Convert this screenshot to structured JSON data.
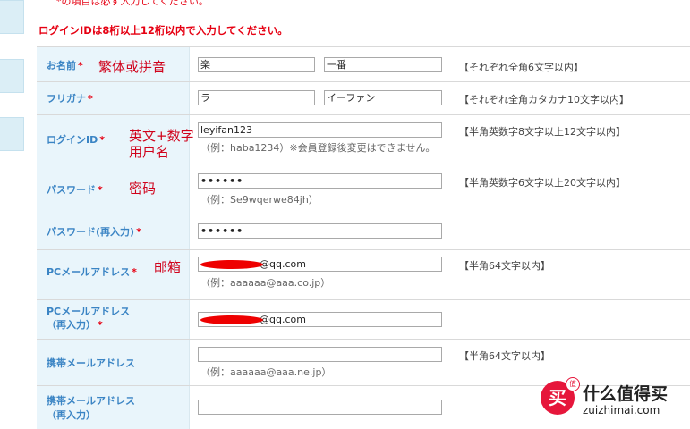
{
  "notice_required": "*の項目は必ず入力してください。",
  "warning": "ログインIDは8桁以上12桁以内で入力してください。",
  "rows": {
    "name": {
      "label": "お名前",
      "required_mark": "*",
      "annotation": "繁体或拼音",
      "last_value": "楽",
      "first_value": "一番",
      "rule": "【それぞれ全角6文字以内】"
    },
    "furigana": {
      "label": "フリガナ",
      "required_mark": "*",
      "last_value": "ラ",
      "first_value": "イーファン",
      "rule": "【それぞれ全角カタカナ10文字以内】"
    },
    "login_id": {
      "label": "ログインID",
      "required_mark": "*",
      "annotation_line1": "英文+数字",
      "annotation_line2": "用户名",
      "value": "leyifan123",
      "hint": "（例：haba1234）※会員登録後変更はできません。",
      "rule": "【半角英数字8文字以上12文字以内】"
    },
    "password": {
      "label": "パスワード",
      "required_mark": "*",
      "annotation": "密码",
      "value": "••••••",
      "hint": "（例：Se9wqerwe84jh）",
      "rule": "【半角英数字6文字以上20文字以内】"
    },
    "password_confirm": {
      "label": "パスワード(再入力)",
      "required_mark": "*",
      "value": "••••••"
    },
    "pc_email": {
      "label": "PCメールアドレス",
      "required_mark": "*",
      "annotation": "邮箱",
      "value": "@qq.com",
      "hint": "（例：aaaaaa@aaa.co.jp）",
      "rule": "【半角64文字以内】"
    },
    "pc_email_confirm": {
      "label_line1": "PCメールアドレス",
      "label_line2": "（再入力）",
      "required_mark": "*",
      "value": "@qq.com"
    },
    "mobile_email": {
      "label": "携帯メールアドレス",
      "value": "",
      "hint": "（例：aaaaaa@aaa.ne.jp）",
      "rule": "【半角64文字以内】"
    },
    "mobile_email_confirm": {
      "label_line1": "携帯メールアドレス",
      "label_line2": "（再入力）",
      "value": ""
    }
  },
  "watermark": {
    "logo_glyph": "买",
    "badge": "值",
    "brand": "什么值得买",
    "url": "zuizhimai.com"
  }
}
